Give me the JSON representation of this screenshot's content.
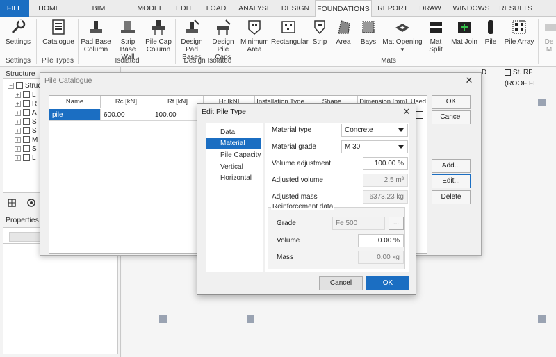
{
  "menu": {
    "tabs": [
      "FILE",
      "HOME",
      "BIM INTEGRATION",
      "MODEL",
      "EDIT",
      "LOAD",
      "ANALYSE",
      "DESIGN",
      "FOUNDATIONS",
      "REPORT",
      "DRAW",
      "WINDOWS",
      "RESULTS"
    ],
    "active": "FOUNDATIONS"
  },
  "ribbon": {
    "settings": "Settings",
    "catalogue": "Catalogue",
    "pad_base_column": "Pad Base Column",
    "strip_base_wall": "Strip Base Wall",
    "pile_cap_column": "Pile Cap Column",
    "design_pad_bases": "Design Pad Bases",
    "design_pile_caps": "Design Pile Caps",
    "minimum_area": "Minimum Area",
    "rectangular": "Rectangular",
    "strip": "Strip",
    "area": "Area",
    "bays": "Bays",
    "mat_opening": "Mat Opening",
    "mat_split": "Mat Split",
    "mat_join": "Mat Join",
    "pile": "Pile",
    "pile_array": "Pile Array",
    "cut_label": "De M",
    "groups": {
      "settings": "Settings",
      "pile_types": "Pile Types",
      "isolated": "Isolated",
      "design_isolated": "Design Isolated",
      "mats": "Mats"
    }
  },
  "left": {
    "structure_title": "Structure",
    "tree_root": "Struc",
    "tree_items": [
      "L",
      "R",
      "A",
      "S",
      "S",
      "M",
      "S",
      "L"
    ],
    "properties_title": "Properties"
  },
  "view": {
    "tab_letter": "D",
    "tab_label": "St. RF (ROOF FL"
  },
  "pile_catalogue": {
    "title": "Pile Catalogue",
    "columns": [
      "Name",
      "Rc [kN]",
      "Rt [kN]",
      "Hr [kN]",
      "Installation Type",
      "Shape",
      "Dimension [mm]",
      "Used"
    ],
    "rows": [
      {
        "name": "pile",
        "rc": "600.00",
        "rt": "100.00"
      }
    ],
    "buttons": {
      "ok": "OK",
      "cancel": "Cancel",
      "add": "Add...",
      "edit": "Edit...",
      "delete": "Delete"
    }
  },
  "edit_pile_type": {
    "title": "Edit Pile Type",
    "nav": [
      "Data",
      "Material",
      "Pile Capacity",
      "Vertical",
      "Horizontal"
    ],
    "selected_nav": "Material",
    "material_type_label": "Material type",
    "material_type_value": "Concrete",
    "material_grade_label": "Material grade",
    "material_grade_value": "M 30",
    "volume_adjustment_label": "Volume adjustment",
    "volume_adjustment_value": "100.00 %",
    "adjusted_volume_label": "Adjusted volume",
    "adjusted_volume_value": "2.5 m³",
    "adjusted_mass_label": "Adjusted mass",
    "adjusted_mass_value": "6373.23 kg",
    "reinforcement_title": "Reinforcement data",
    "grade_label": "Grade",
    "grade_value": "Fe 500",
    "grade_browse": "...",
    "volume_label": "Volume",
    "volume_value": "0.00 %",
    "mass_label": "Mass",
    "mass_value": "0.00 kg",
    "cancel": "Cancel",
    "ok": "OK"
  },
  "colors": {
    "accent": "#1b6ec2",
    "grid_dot": "#9aa3b2"
  }
}
